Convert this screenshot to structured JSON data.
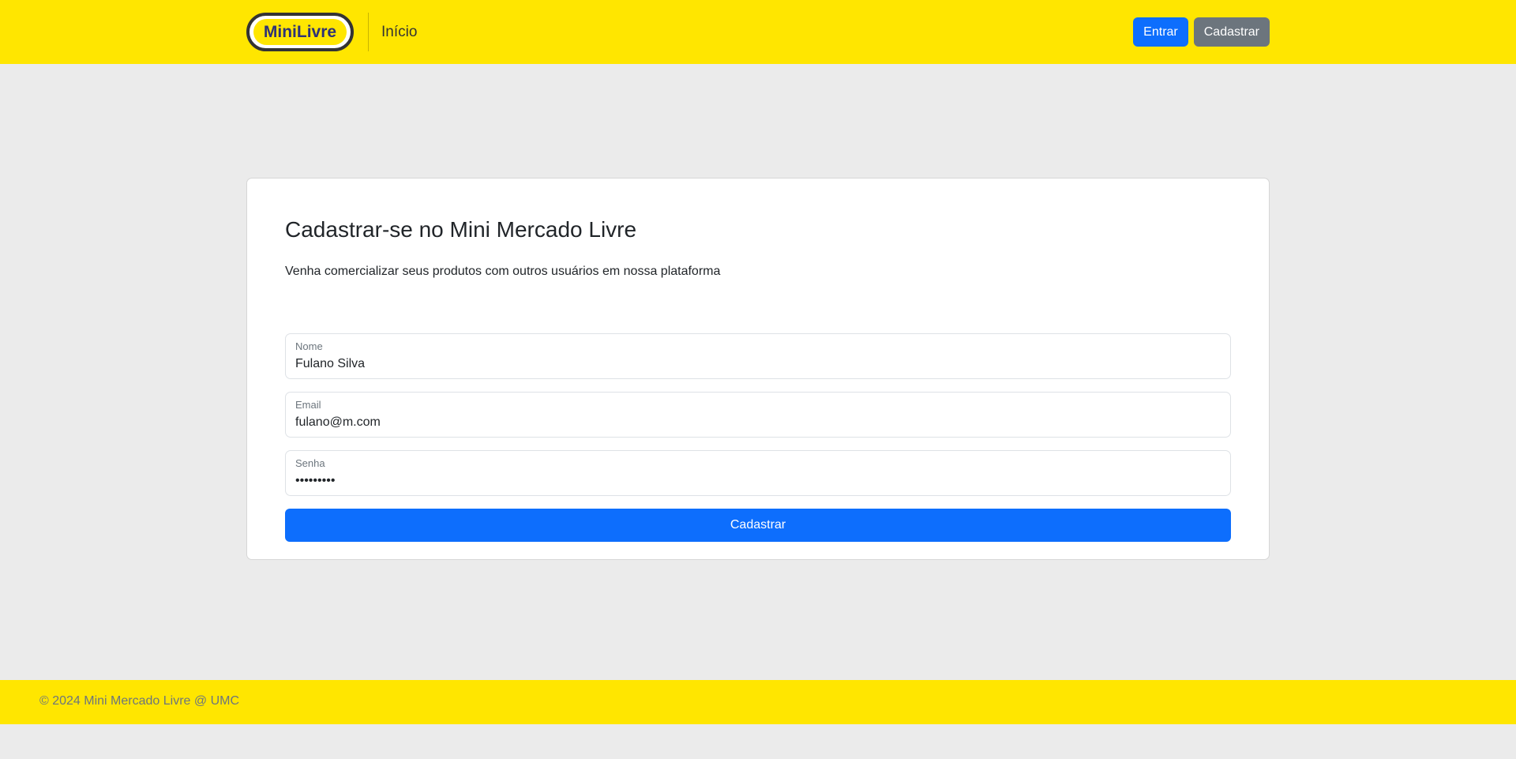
{
  "header": {
    "logo_text": "MiniLivre",
    "nav_link": "Início",
    "login_label": "Entrar",
    "signup_label": "Cadastrar"
  },
  "form": {
    "title": "Cadastrar-se no Mini Mercado Livre",
    "subtitle": "Venha comercializar seus produtos com outros usuários em nossa plataforma",
    "fields": [
      {
        "label": "Nome",
        "value": "Fulano Silva",
        "type": "text"
      },
      {
        "label": "Email",
        "value": "fulano@m.com",
        "type": "email"
      },
      {
        "label": "Senha",
        "value": "123456789",
        "type": "password"
      }
    ],
    "submit_label": "Cadastrar"
  },
  "footer": {
    "text": "© 2024 Mini Mercado Livre @ UMC"
  },
  "colors": {
    "brand_yellow": "#ffe600",
    "primary_blue": "#0d6efd",
    "secondary_gray": "#6c757d",
    "page_background": "#ebebeb"
  }
}
